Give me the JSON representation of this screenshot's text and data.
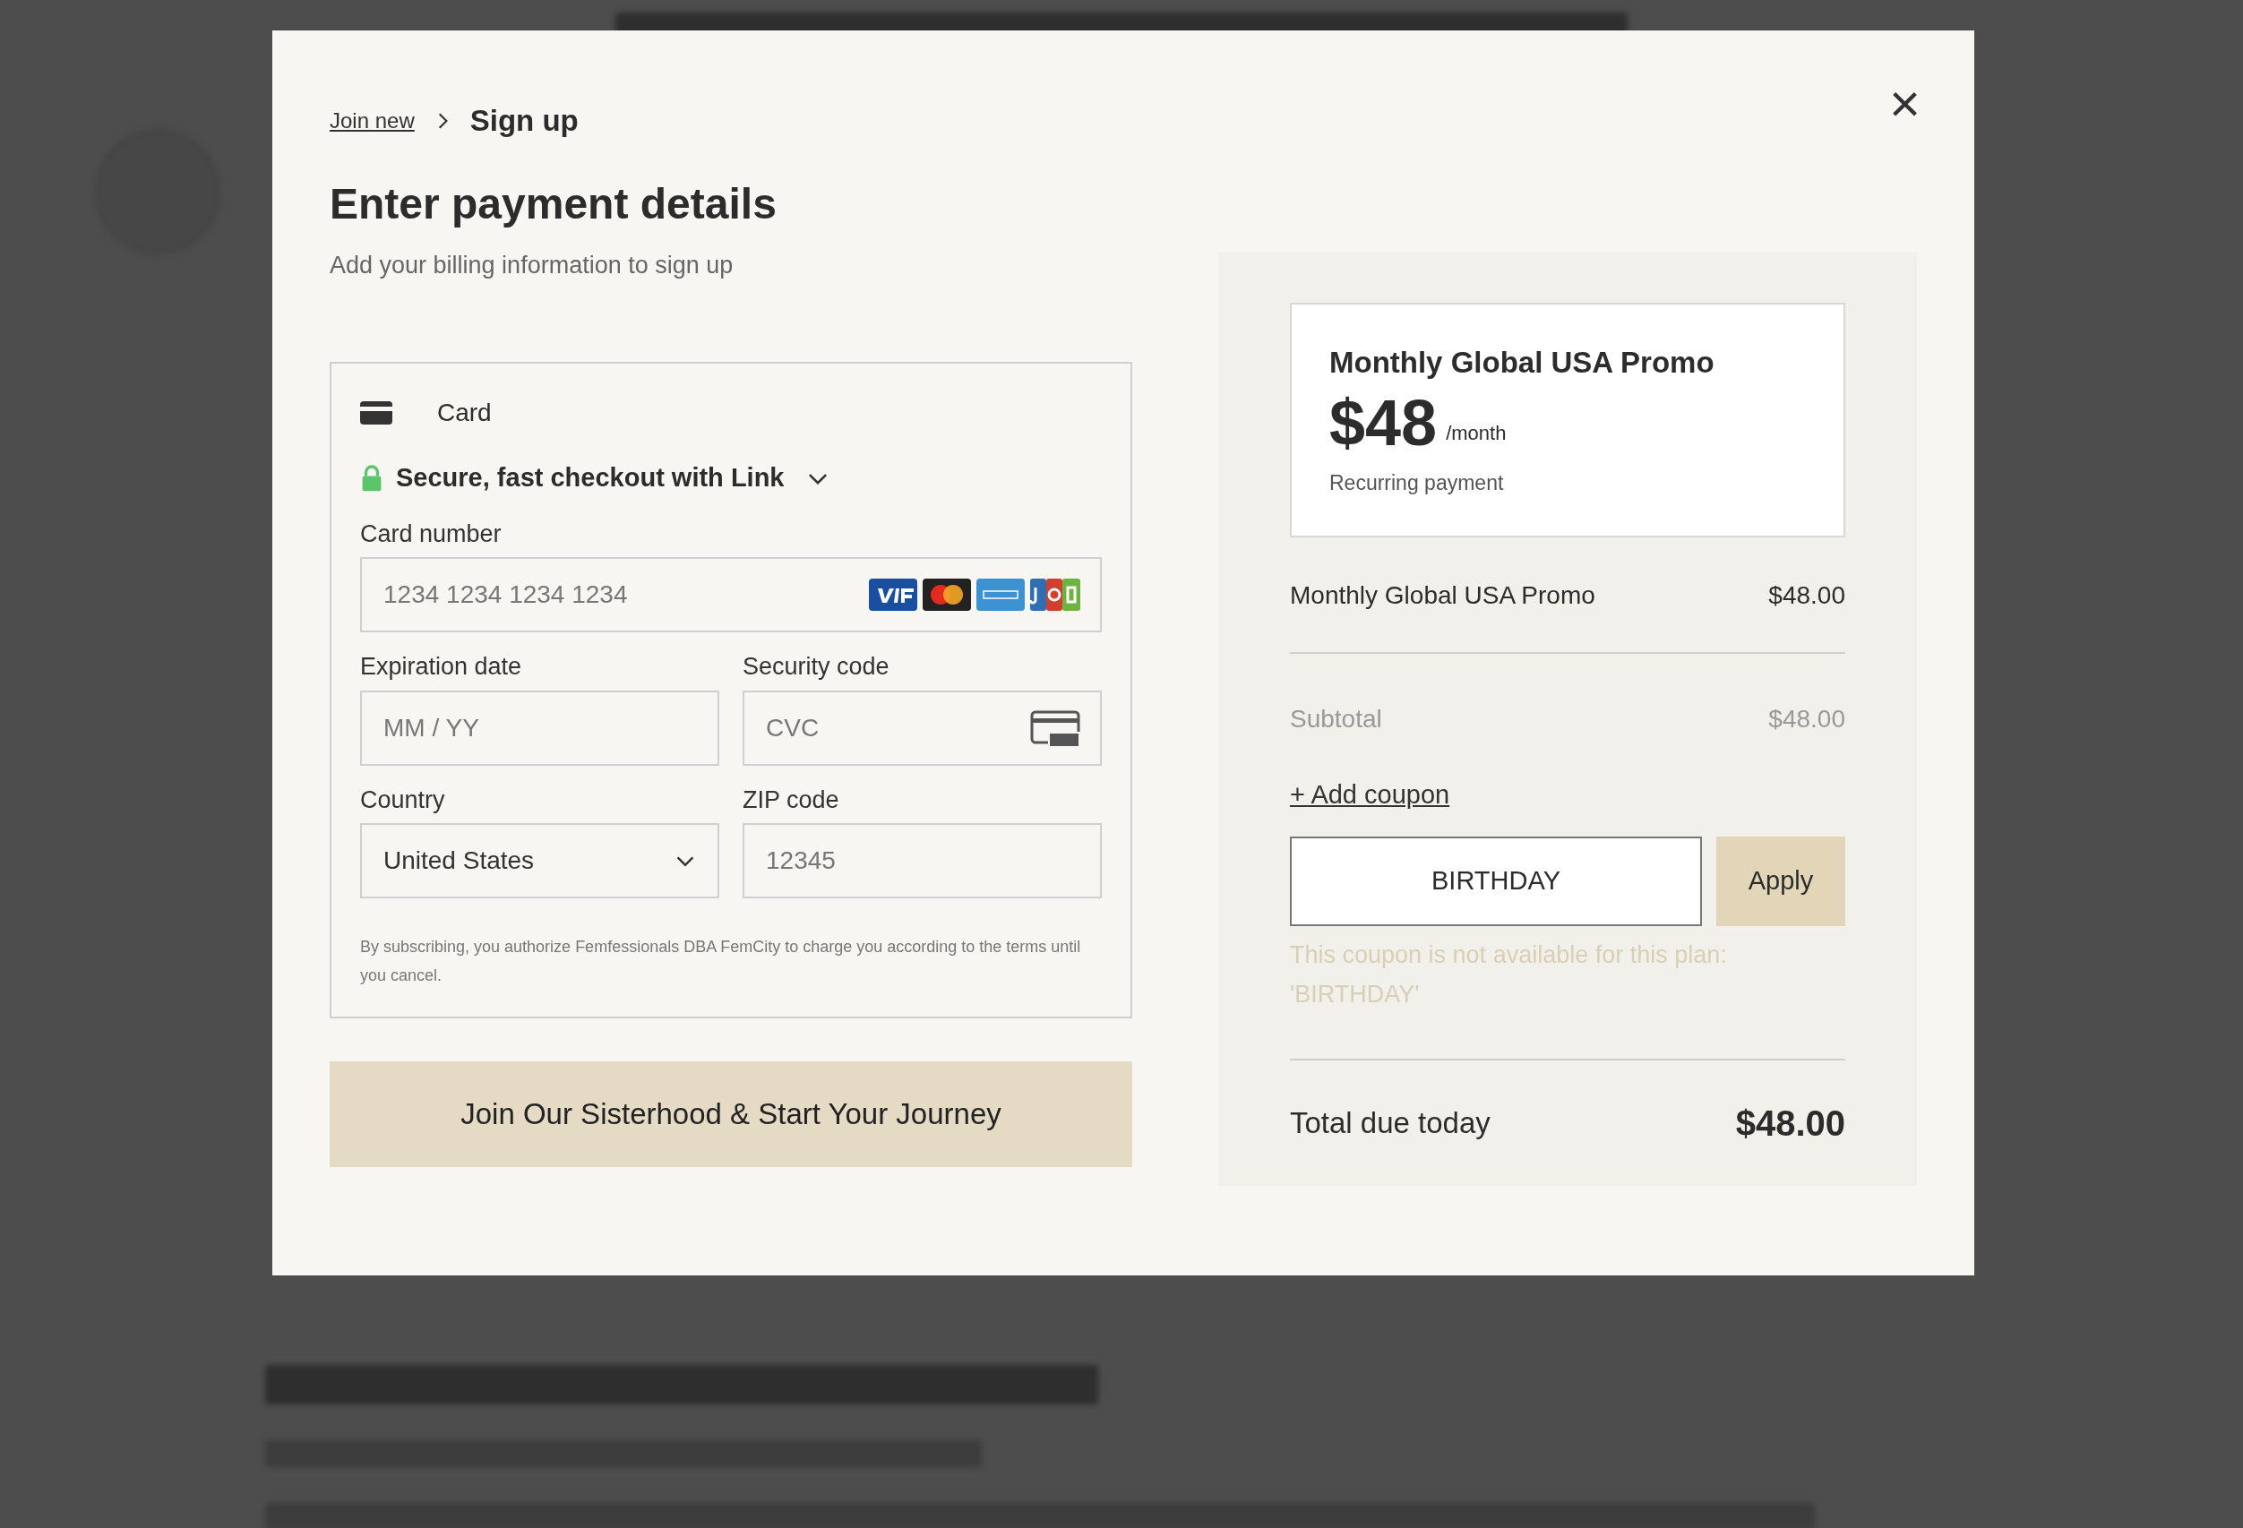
{
  "dialog": {
    "close": "×",
    "breadcrumb": [
      {
        "label": "Join new",
        "kind": "link"
      },
      {
        "label": "Sign up",
        "kind": "current"
      }
    ],
    "title": "Enter payment details",
    "subtitle": "Add your billing information to sign up",
    "payment": {
      "method": "Card",
      "link_checkout": {
        "label": "Secure, fast checkout with Link",
        "expanded": false
      },
      "fields": [
        {
          "kind": "card",
          "label": "Card number",
          "placeholder": "1234 1234 1234 1234"
        },
        {
          "kind": "text",
          "label": "Expiration date",
          "placeholder": "MM / YY"
        },
        {
          "kind": "cvc",
          "label": "Security code",
          "placeholder": "CVC"
        },
        {
          "kind": "select",
          "label": "Country",
          "value": "United States"
        },
        {
          "kind": "text",
          "label": "ZIP code",
          "placeholder": "12345"
        }
      ],
      "disclaimer": "By subscribing, you authorize Femfessionals DBA FemCity to charge you according to the terms until you cancel."
    },
    "submit": "Join Our Sisterhood & Start Your Journey",
    "summary": {
      "plan": {
        "name": "Monthly Global USA Promo",
        "price": "$48",
        "period": "/month",
        "note": "Recurring payment"
      },
      "line": {
        "label": "Monthly Global USA Promo",
        "amount": "$48.00"
      },
      "subtotal": {
        "label": "Subtotal",
        "amount": "$48.00"
      },
      "add_coupon": "+ Add coupon",
      "coupon": {
        "value": "BIRTHDAY",
        "button": "Apply"
      },
      "coupon_error": "This coupon is not available for this plan: 'BIRTHDAY'",
      "total": {
        "label": "Total due today",
        "amount": "$48.00"
      }
    }
  }
}
